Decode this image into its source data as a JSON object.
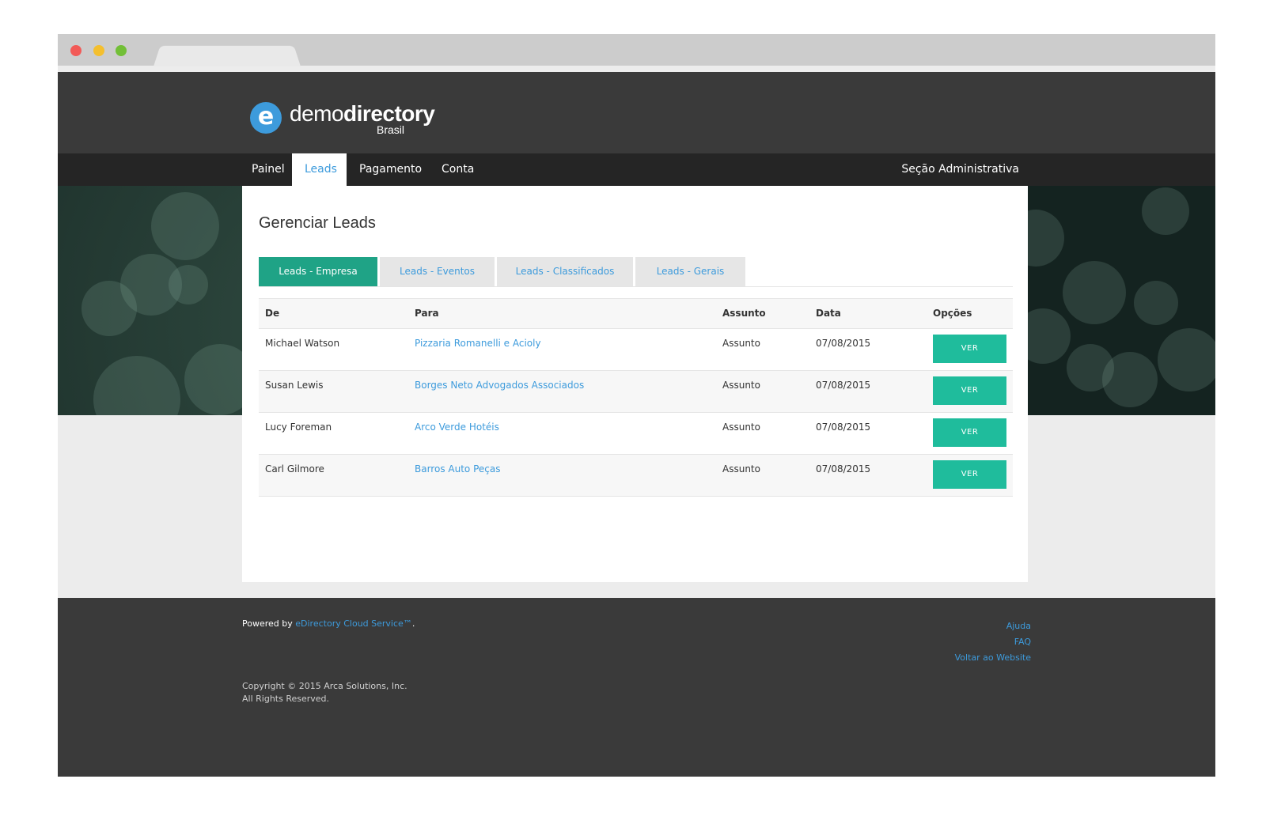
{
  "brand": {
    "logo_glyph": "e",
    "name_light": "demo",
    "name_bold": "directory",
    "subtitle": "Brasil"
  },
  "nav": {
    "items": [
      {
        "label": "Painel",
        "active": false
      },
      {
        "label": "Leads",
        "active": true
      },
      {
        "label": "Pagamento",
        "active": false
      },
      {
        "label": "Conta",
        "active": false
      }
    ],
    "admin_label": "Seção Administrativa"
  },
  "main": {
    "title": "Gerenciar Leads",
    "tabs": [
      {
        "label": "Leads - Empresa",
        "active": true
      },
      {
        "label": "Leads - Eventos",
        "active": false
      },
      {
        "label": "Leads - Classificados",
        "active": false
      },
      {
        "label": "Leads - Gerais",
        "active": false
      }
    ],
    "table": {
      "columns": [
        "De",
        "Para",
        "Assunto",
        "Data",
        "Opções"
      ],
      "rows": [
        {
          "from": "Michael Watson",
          "to": "Pizzaria Romanelli e Acioly",
          "subject": "Assunto",
          "date": "07/08/2015",
          "action": "VER"
        },
        {
          "from": "Susan Lewis",
          "to": "Borges Neto Advogados Associados",
          "subject": "Assunto",
          "date": "07/08/2015",
          "action": "VER"
        },
        {
          "from": "Lucy Foreman",
          "to": "Arco Verde Hotéis",
          "subject": "Assunto",
          "date": "07/08/2015",
          "action": "VER"
        },
        {
          "from": "Carl Gilmore",
          "to": "Barros Auto Peças",
          "subject": "Assunto",
          "date": "07/08/2015",
          "action": "VER"
        }
      ]
    }
  },
  "footer": {
    "powered_prefix": "Powered by ",
    "powered_link": "eDirectory Cloud Service™",
    "powered_suffix": ".",
    "links": [
      "Ajuda",
      "FAQ",
      "Voltar ao Website"
    ],
    "copyright_line1": "Copyright © 2015 Arca Solutions, Inc.",
    "copyright_line2": "All Rights Reserved."
  },
  "colors": {
    "accent": "#3d9bdc",
    "tab_active": "#1fa386",
    "button": "#1fbc9c",
    "header": "#3a3a3a",
    "nav": "#252525"
  }
}
